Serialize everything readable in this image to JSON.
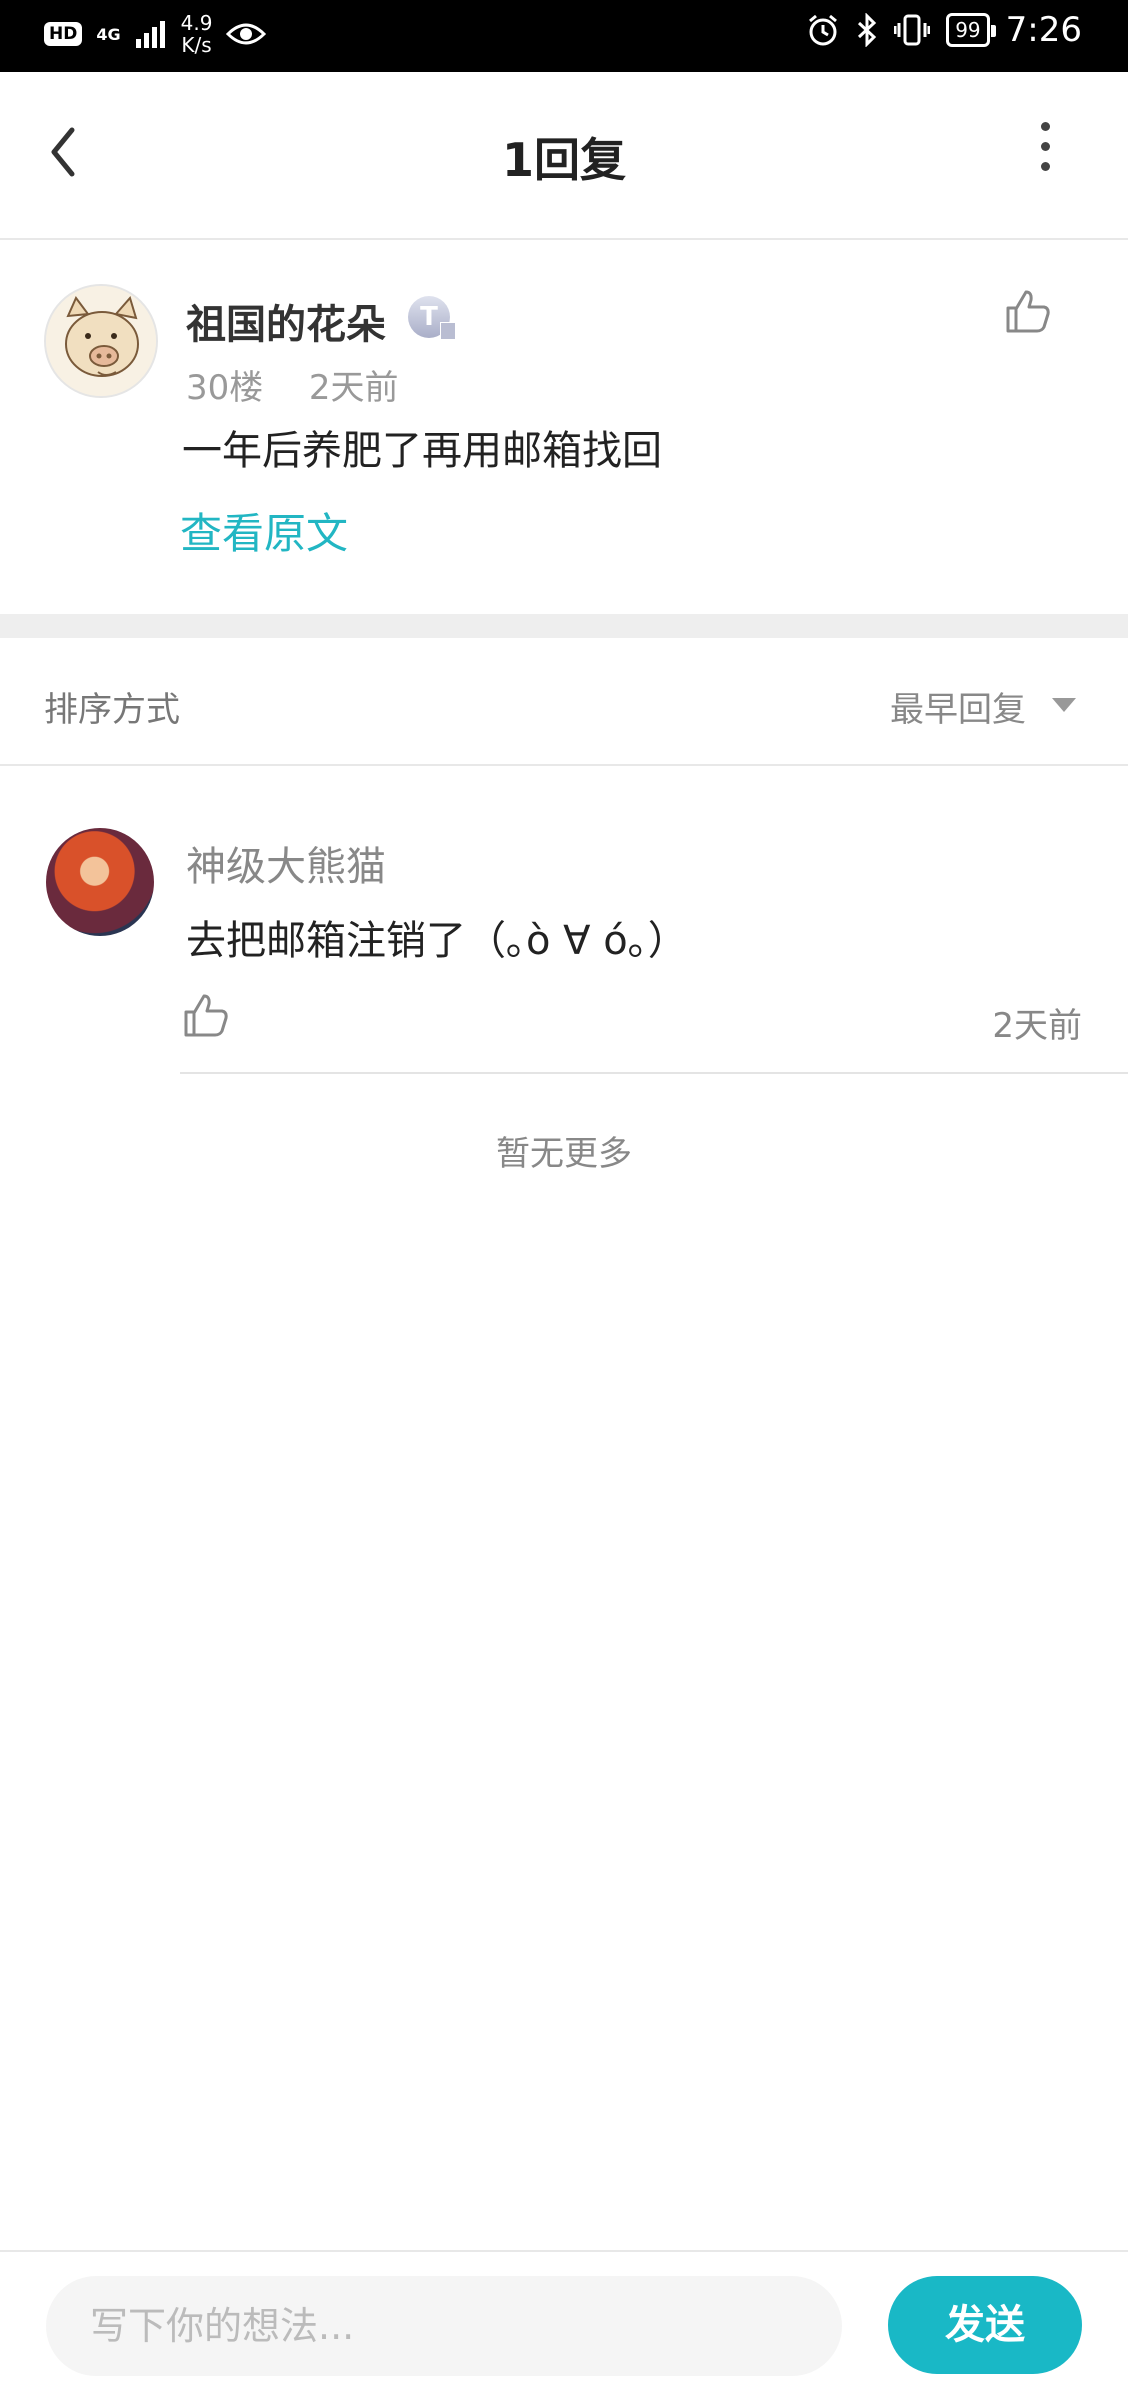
{
  "status_bar": {
    "hd": "HD",
    "signal": "4G",
    "speed_value": "4.9",
    "speed_unit": "K/s",
    "battery": "99",
    "time": "7:26"
  },
  "header": {
    "title": "1回复"
  },
  "post": {
    "author": "祖国的花朵",
    "badge": "T",
    "floor": "30楼",
    "time": "2天前",
    "content": "一年后养肥了再用邮箱找回",
    "view_original": "查看原文"
  },
  "sort": {
    "label": "排序方式",
    "value": "最早回复"
  },
  "replies": [
    {
      "author": "神级大熊猫",
      "content": "去把邮箱注销了（｡ò ∀ ó｡）",
      "time": "2天前"
    }
  ],
  "no_more": "暂无更多",
  "composer": {
    "placeholder": "写下你的想法...",
    "send_label": "发送"
  },
  "colors": {
    "accent": "#19b8c6",
    "link": "#22b6c3"
  }
}
